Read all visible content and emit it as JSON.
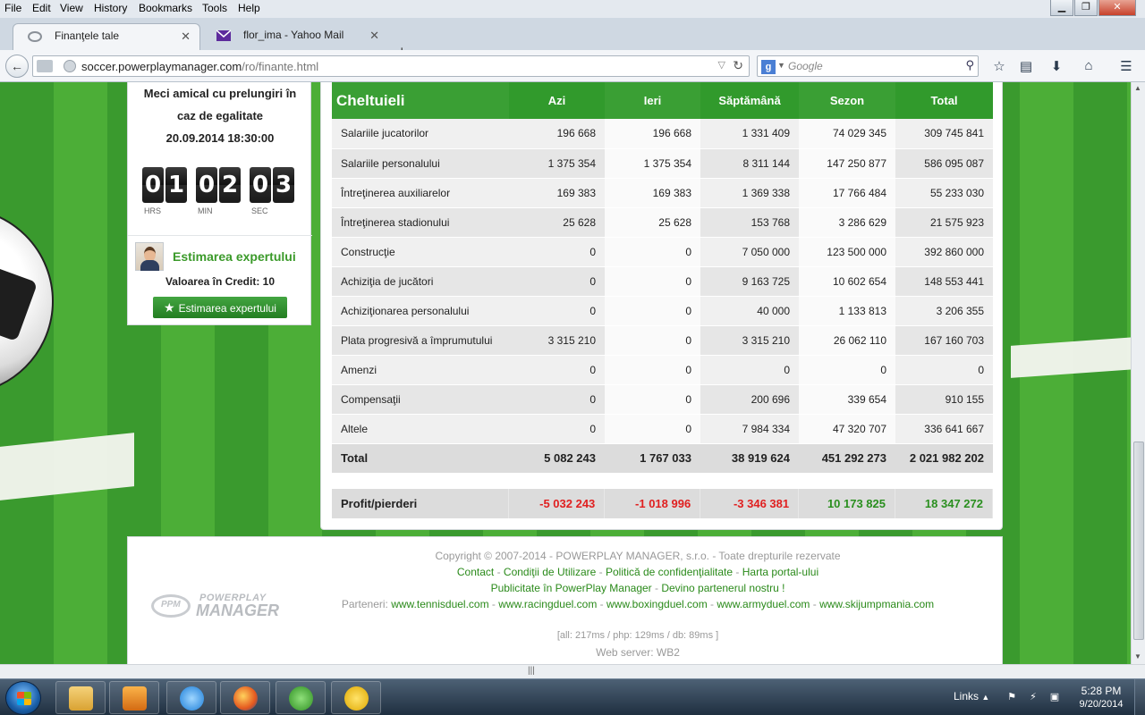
{
  "menubar": {
    "items": [
      "File",
      "Edit",
      "View",
      "History",
      "Bookmarks",
      "Tools",
      "Help"
    ]
  },
  "tabs": [
    {
      "title": "Finanţele tale",
      "active": true
    },
    {
      "title": "flor_ima - Yahoo Mail",
      "active": false
    }
  ],
  "urlbar": {
    "url_host": "soccer.powerplaymanager.com",
    "url_path": "/ro/finante.html"
  },
  "search": {
    "placeholder": "Google"
  },
  "sidebar": {
    "match_line1": "Meci amical cu prelungiri în",
    "match_line2": "caz de egalitate",
    "match_datetime": "20.09.2014 18:30:00",
    "countdown": {
      "hours": "01",
      "minutes": "02",
      "seconds": "03",
      "hrs_label": "HRS",
      "min_label": "MIN",
      "sec_label": "SEC"
    },
    "expert_title": "Estimarea expertului",
    "credit_label": "Valoarea în Credit:",
    "credit_value": "10",
    "expert_button": "Estimarea expertului"
  },
  "finance_table": {
    "header": [
      "Cheltuieli",
      "Azi",
      "Ieri",
      "Săptămână",
      "Sezon",
      "Total"
    ],
    "rows": [
      [
        "Salariile jucatorilor",
        "196 668",
        "196 668",
        "1 331 409",
        "74 029 345",
        "309 745 841"
      ],
      [
        "Salariile personalului",
        "1 375 354",
        "1 375 354",
        "8 311 144",
        "147 250 877",
        "586 095 087"
      ],
      [
        "Întreţinerea auxiliarelor",
        "169 383",
        "169 383",
        "1 369 338",
        "17 766 484",
        "55 233 030"
      ],
      [
        "Întreţinerea stadionului",
        "25 628",
        "25 628",
        "153 768",
        "3 286 629",
        "21 575 923"
      ],
      [
        "Construcţie",
        "0",
        "0",
        "7 050 000",
        "123 500 000",
        "392 860 000"
      ],
      [
        "Achiziţia de jucători",
        "0",
        "0",
        "9 163 725",
        "10 602 654",
        "148 553 441"
      ],
      [
        "Achiziţionarea personalului",
        "0",
        "0",
        "40 000",
        "1 133 813",
        "3 206 355"
      ],
      [
        "Plata progresivă a împrumutului",
        "3 315 210",
        "0",
        "3 315 210",
        "26 062 110",
        "167 160 703"
      ],
      [
        "Amenzi",
        "0",
        "0",
        "0",
        "0",
        "0"
      ],
      [
        "Compensaţii",
        "0",
        "0",
        "200 696",
        "339 654",
        "910 155"
      ],
      [
        "Altele",
        "0",
        "0",
        "7 984 334",
        "47 320 707",
        "336 641 667"
      ]
    ],
    "total": [
      "Total",
      "5 082 243",
      "1 767 033",
      "38 919 624",
      "451 292 273",
      "2 021 982 202"
    ],
    "profit": [
      "Profit/pierderi",
      "-5 032 243",
      "-1 018 996",
      "-3 346 381",
      "10 173 825",
      "18 347 272"
    ],
    "colors": {
      "header_green": "#3a9f34",
      "negative": "#e02020",
      "positive": "#2a8f1f"
    }
  },
  "footer": {
    "copyright": "Copyright © 2007-2014 - POWERPLAY MANAGER, s.r.o. - Toate drepturile rezervate",
    "links1": [
      "Contact",
      "Condiţii de Utilizare",
      "Politică de confidenţialitate",
      "Harta portal-ului"
    ],
    "links2": [
      "Publicitate în PowerPlay Manager",
      "Devino partenerul nostru !"
    ],
    "partners_label": "Parteneri:",
    "partners": [
      "www.tennisduel.com",
      "www.racingduel.com",
      "www.boxingduel.com",
      "www.armyduel.com",
      "www.skijumpmania.com"
    ],
    "timing": "[all: 217ms / php: 129ms / db: 89ms ]",
    "webserver": "Web server: WB2",
    "logo_top": "POWERPLAY",
    "logo_bottom": "MANAGER",
    "logo_ring": "PPM"
  },
  "taskbar": {
    "links_label": "Links",
    "time": "5:28 PM",
    "date": "9/20/2014"
  }
}
